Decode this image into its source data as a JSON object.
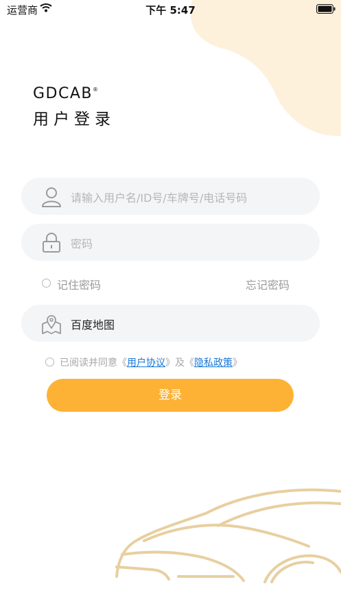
{
  "status_bar": {
    "carrier": "运营商",
    "time": "下午 5:47"
  },
  "brand": {
    "logo_text": "GDCAB",
    "trademark": "®",
    "title": "用户登录"
  },
  "form": {
    "username_placeholder": "请输入用户名/ID号/车牌号/电话号码",
    "password_placeholder": "密码",
    "remember_label": "记住密码",
    "forgot_label": "忘记密码",
    "map_value": "百度地图"
  },
  "agreement": {
    "prefix": "已阅读并同意《",
    "user_agreement": "用户协议",
    "middle": "》及《",
    "privacy_policy": "隐私政策",
    "suffix": "》"
  },
  "login_button": "登录",
  "colors": {
    "accent": "#fdb235",
    "decor_blob": "#fdf1dc",
    "car_outline": "#e8cfa0",
    "link": "#1677d8",
    "field_bg": "#f4f5f7"
  },
  "icons": [
    "wifi-icon",
    "battery-icon",
    "user-icon",
    "lock-icon",
    "map-pin-icon",
    "car-illustration"
  ]
}
